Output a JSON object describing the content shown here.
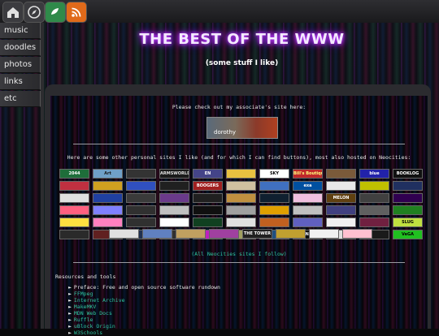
{
  "toolbar": {
    "icons": [
      "home-icon",
      "compass-icon",
      "guestbook-icon",
      "rss-icon"
    ]
  },
  "sidebar": {
    "items": [
      {
        "label": "music"
      },
      {
        "label": "doodles"
      },
      {
        "label": "photos"
      },
      {
        "label": "links"
      },
      {
        "label": "etc"
      }
    ]
  },
  "header": {
    "title": "THE BEST OF THE WWW",
    "subtitle": "(some stuff I like)"
  },
  "associate": {
    "text": "Please check out my associate's site here:",
    "button_label": "dorothy"
  },
  "sites": {
    "intro": "Here are some other personal sites I like (and for which I can find buttons), most also hosted on Neocities:",
    "buttons": [
      {
        "label": "2044",
        "bg": "#1e6e3a",
        "fg": "#ffffff"
      },
      {
        "label": "Art",
        "bg": "#6fa0c8",
        "fg": "#1a1a1a"
      },
      {
        "label": "",
        "bg": "#333333",
        "fg": "#ffffff"
      },
      {
        "label": "ARMSWORLD",
        "bg": "#1a1a1a",
        "fg": "#e0e0e0"
      },
      {
        "label": "EN",
        "bg": "#444488",
        "fg": "#ffffff"
      },
      {
        "label": "",
        "bg": "#e8c040",
        "fg": "#000000"
      },
      {
        "label": "SKY",
        "bg": "#ffffff",
        "fg": "#000000"
      },
      {
        "label": "Bill's Boutique",
        "bg": "#c0282a",
        "fg": "#ffff80"
      },
      {
        "label": "",
        "bg": "#7a5a3a",
        "fg": "#ffffff"
      },
      {
        "label": "blue",
        "bg": "#2222aa",
        "fg": "#ffffff"
      },
      {
        "label": "BOOKLOG",
        "bg": "#101010",
        "fg": "#ffffff"
      },
      {
        "label": "",
        "bg": "#c03040",
        "fg": "#ffffff"
      },
      {
        "label": "",
        "bg": "#d0a020",
        "fg": "#000000"
      },
      {
        "label": "",
        "bg": "#3050c0",
        "fg": "#ffffff"
      },
      {
        "label": "",
        "bg": "#202020",
        "fg": "#ffffff"
      },
      {
        "label": "BOOGERS",
        "bg": "#a02020",
        "fg": "#ffffff"
      },
      {
        "label": "",
        "bg": "#d0c0a0",
        "fg": "#000000"
      },
      {
        "label": "",
        "bg": "#4070c0",
        "fg": "#ffffff"
      },
      {
        "label": "exa",
        "bg": "#0050a0",
        "fg": "#ffffff"
      },
      {
        "label": "",
        "bg": "#e8e8e8",
        "fg": "#000000"
      },
      {
        "label": "",
        "bg": "#c0c000",
        "fg": "#000000"
      },
      {
        "label": "",
        "bg": "#203060",
        "fg": "#ffffff"
      },
      {
        "label": "",
        "bg": "#e0e0e0",
        "fg": "#000000"
      },
      {
        "label": "",
        "bg": "#2040a0",
        "fg": "#ffffff"
      },
      {
        "label": "",
        "bg": "#3a3a3a",
        "fg": "#ffffff"
      },
      {
        "label": "",
        "bg": "#6a3a8a",
        "fg": "#ffffff"
      },
      {
        "label": "",
        "bg": "#202020",
        "fg": "#ffffff"
      },
      {
        "label": "",
        "bg": "#c09040",
        "fg": "#000000"
      },
      {
        "label": "",
        "bg": "#102030",
        "fg": "#ffffff"
      },
      {
        "label": "",
        "bg": "#f0c0e0",
        "fg": "#000000"
      },
      {
        "label": "MELON",
        "bg": "#604010",
        "fg": "#ffffff"
      },
      {
        "label": "",
        "bg": "#404040",
        "fg": "#ffffff"
      },
      {
        "label": "",
        "bg": "#300050",
        "fg": "#ffffff"
      },
      {
        "label": "",
        "bg": "#ff6080",
        "fg": "#ffffff"
      },
      {
        "label": "",
        "bg": "#8080ff",
        "fg": "#000000"
      },
      {
        "label": "",
        "bg": "#303030",
        "fg": "#ffffff"
      },
      {
        "label": "",
        "bg": "#c0c0c0",
        "fg": "#000000"
      },
      {
        "label": "",
        "bg": "#101010",
        "fg": "#ffffff"
      },
      {
        "label": "",
        "bg": "#a0a0a0",
        "fg": "#000000"
      },
      {
        "label": "",
        "bg": "#e0a000",
        "fg": "#000000"
      },
      {
        "label": "",
        "bg": "#c0c0c0",
        "fg": "#000000"
      },
      {
        "label": "",
        "bg": "#404080",
        "fg": "#ffffff"
      },
      {
        "label": "",
        "bg": "#606060",
        "fg": "#ffffff"
      },
      {
        "label": "",
        "bg": "#208020",
        "fg": "#ffffff"
      },
      {
        "label": "",
        "bg": "#ffe040",
        "fg": "#000000"
      },
      {
        "label": "",
        "bg": "#ff80c0",
        "fg": "#000000"
      },
      {
        "label": "",
        "bg": "#303030",
        "fg": "#ffffff"
      },
      {
        "label": "",
        "bg": "#ffffff",
        "fg": "#000000"
      },
      {
        "label": "",
        "bg": "#104020",
        "fg": "#ffffff"
      },
      {
        "label": "",
        "bg": "#e0e0e0",
        "fg": "#000000"
      },
      {
        "label": "",
        "bg": "#c06020",
        "fg": "#ffffff"
      },
      {
        "label": "",
        "bg": "#6060c0",
        "fg": "#ffffff"
      },
      {
        "label": "",
        "bg": "#f0f0f0",
        "fg": "#000000"
      },
      {
        "label": "",
        "bg": "#702040",
        "fg": "#ffffff"
      },
      {
        "label": "SLUG",
        "bg": "#c0e040",
        "fg": "#000000"
      },
      {
        "label": "",
        "bg": "#2a2a2a",
        "fg": "#ffffff"
      },
      {
        "label": "",
        "bg": "#602020",
        "fg": "#ffffff"
      },
      {
        "label": "",
        "bg": "#203050",
        "fg": "#ffffff"
      },
      {
        "label": "",
        "bg": "#303030",
        "fg": "#ffffff"
      },
      {
        "label": "",
        "bg": "#c020c0",
        "fg": "#ffffff"
      },
      {
        "label": "",
        "bg": "#a0a060",
        "fg": "#000000"
      },
      {
        "label": "",
        "bg": "#205080",
        "fg": "#ffffff"
      },
      {
        "label": "TECHNOMANCY",
        "bg": "#101010",
        "fg": "#ffffff"
      },
      {
        "label": "",
        "bg": "#e0e0e0",
        "fg": "#000000"
      },
      {
        "label": "",
        "bg": "#1a1a1a",
        "fg": "#ffffff"
      },
      {
        "label": "VeGA",
        "bg": "#20c020",
        "fg": "#000000"
      }
    ],
    "last_row": [
      {
        "label": "",
        "bg": "#e0e0e0",
        "fg": "#000000"
      },
      {
        "label": "",
        "bg": "#6080c0",
        "fg": "#ffffff"
      },
      {
        "label": "",
        "bg": "#c0a060",
        "fg": "#000000"
      },
      {
        "label": "",
        "bg": "#a040a0",
        "fg": "#ffffff"
      },
      {
        "label": "THE TOWER",
        "bg": "#202020",
        "fg": "#ffffff"
      },
      {
        "label": "",
        "bg": "#c0a030",
        "fg": "#000000"
      },
      {
        "label": "",
        "bg": "#f0f0f0",
        "fg": "#000000"
      },
      {
        "label": "",
        "bg": "#ffc0d0",
        "fg": "#000000"
      }
    ],
    "all_link": "(All Neocities sites I follow)"
  },
  "tools": {
    "heading": "Resources and tools",
    "items": [
      {
        "label": "Preface: Free and open source software rundown"
      },
      {
        "label": "FFMpeg"
      },
      {
        "label": "Internet Archive"
      },
      {
        "label": "MakeMKV"
      },
      {
        "label": "MDN Web Docs"
      },
      {
        "label": "Ruffle"
      },
      {
        "label": "uBlock Origin"
      },
      {
        "label": "W3Schools"
      }
    ]
  }
}
